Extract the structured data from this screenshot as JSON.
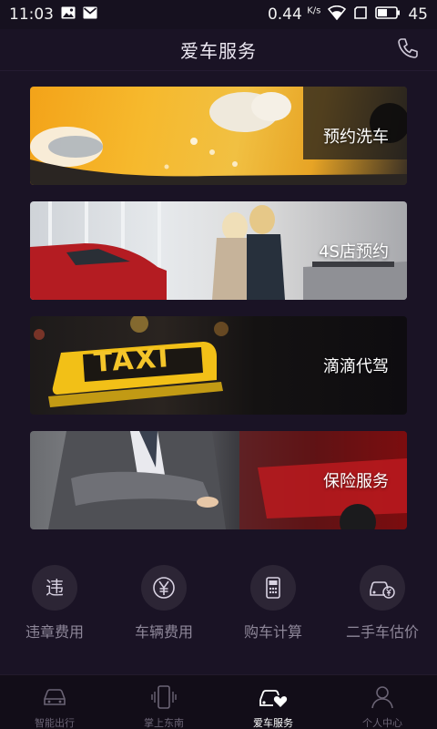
{
  "status_bar": {
    "time": "11:03",
    "net_speed": "0.44",
    "net_unit": "K/s",
    "battery": "45"
  },
  "header": {
    "title": "爱车服务"
  },
  "services": [
    {
      "label": "预约洗车"
    },
    {
      "label": "4S店预约"
    },
    {
      "label": "滴滴代驾"
    },
    {
      "label": "保险服务"
    }
  ],
  "taxi_sign_text": "TAXI",
  "tools": [
    {
      "label": "违章费用",
      "icon": "violation-fee-icon"
    },
    {
      "label": "车辆费用",
      "icon": "yen-icon"
    },
    {
      "label": "购车计算",
      "icon": "calculator-icon"
    },
    {
      "label": "二手车估价",
      "icon": "used-car-valuation-icon"
    }
  ],
  "bottom_nav": [
    {
      "label": "智能出行",
      "icon": "car-icon",
      "active": false
    },
    {
      "label": "掌上东南",
      "icon": "phone-vibrate-icon",
      "active": false
    },
    {
      "label": "爱车服务",
      "icon": "car-heart-icon",
      "active": true
    },
    {
      "label": "个人中心",
      "icon": "person-icon",
      "active": false
    }
  ],
  "colors": {
    "background": "#1a1325",
    "nav_background": "#120d18",
    "tool_circle": "#2c2535",
    "inactive_text": "#8e8799"
  }
}
